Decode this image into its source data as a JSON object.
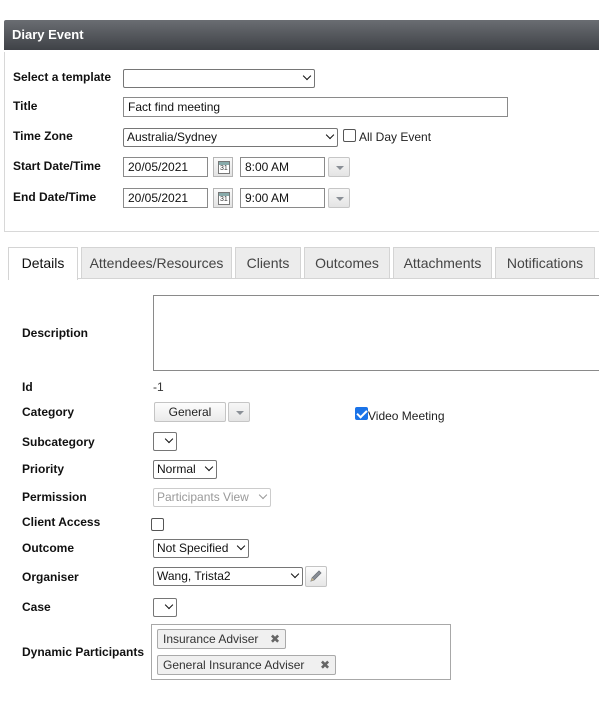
{
  "window": {
    "title": "Diary Event"
  },
  "header_form": {
    "template": {
      "label": "Select a template",
      "value": ""
    },
    "title": {
      "label": "Title",
      "value": "Fact find meeting"
    },
    "timezone": {
      "label": "Time Zone",
      "value": "Australia/Sydney"
    },
    "all_day": {
      "label": "All Day Event",
      "checked": false
    },
    "start": {
      "label": "Start Date/Time",
      "date": "20/05/2021",
      "time": "8:00 AM"
    },
    "end": {
      "label": "End Date/Time",
      "date": "20/05/2021",
      "time": "9:00 AM"
    },
    "calendar_icon_text": "31"
  },
  "tabs": [
    {
      "label": "Details",
      "active": true
    },
    {
      "label": "Attendees/Resources"
    },
    {
      "label": "Clients"
    },
    {
      "label": "Outcomes"
    },
    {
      "label": "Attachments"
    },
    {
      "label": "Notifications"
    }
  ],
  "details": {
    "description": {
      "label": "Description",
      "value": ""
    },
    "id": {
      "label": "Id",
      "value": "-1"
    },
    "category": {
      "label": "Category",
      "value": "General"
    },
    "video_meeting": {
      "label": "Video Meeting",
      "checked": true
    },
    "subcategory": {
      "label": "Subcategory",
      "value": ""
    },
    "priority": {
      "label": "Priority",
      "value": "Normal"
    },
    "permission": {
      "label": "Permission",
      "value": "Participants View"
    },
    "client_access": {
      "label": "Client Access",
      "checked": false
    },
    "outcome": {
      "label": "Outcome",
      "value": "Not Specified"
    },
    "organiser": {
      "label": "Organiser",
      "value": "Wang, Trista2"
    },
    "case": {
      "label": "Case",
      "value": ""
    },
    "dynamic_participants": {
      "label": "Dynamic Participants",
      "tags": [
        "Insurance Adviser",
        "General Insurance Adviser"
      ],
      "remove_glyph": "✖"
    }
  },
  "icons": {
    "calendar": "calendar-icon",
    "dropdown": "chevron-down-icon",
    "edit": "pencil-icon",
    "remove": "close-icon"
  },
  "colors": {
    "titlebar": "#4a4d52",
    "checkbox_checked": "#1a73e8",
    "tab_inactive": "#ececec"
  }
}
